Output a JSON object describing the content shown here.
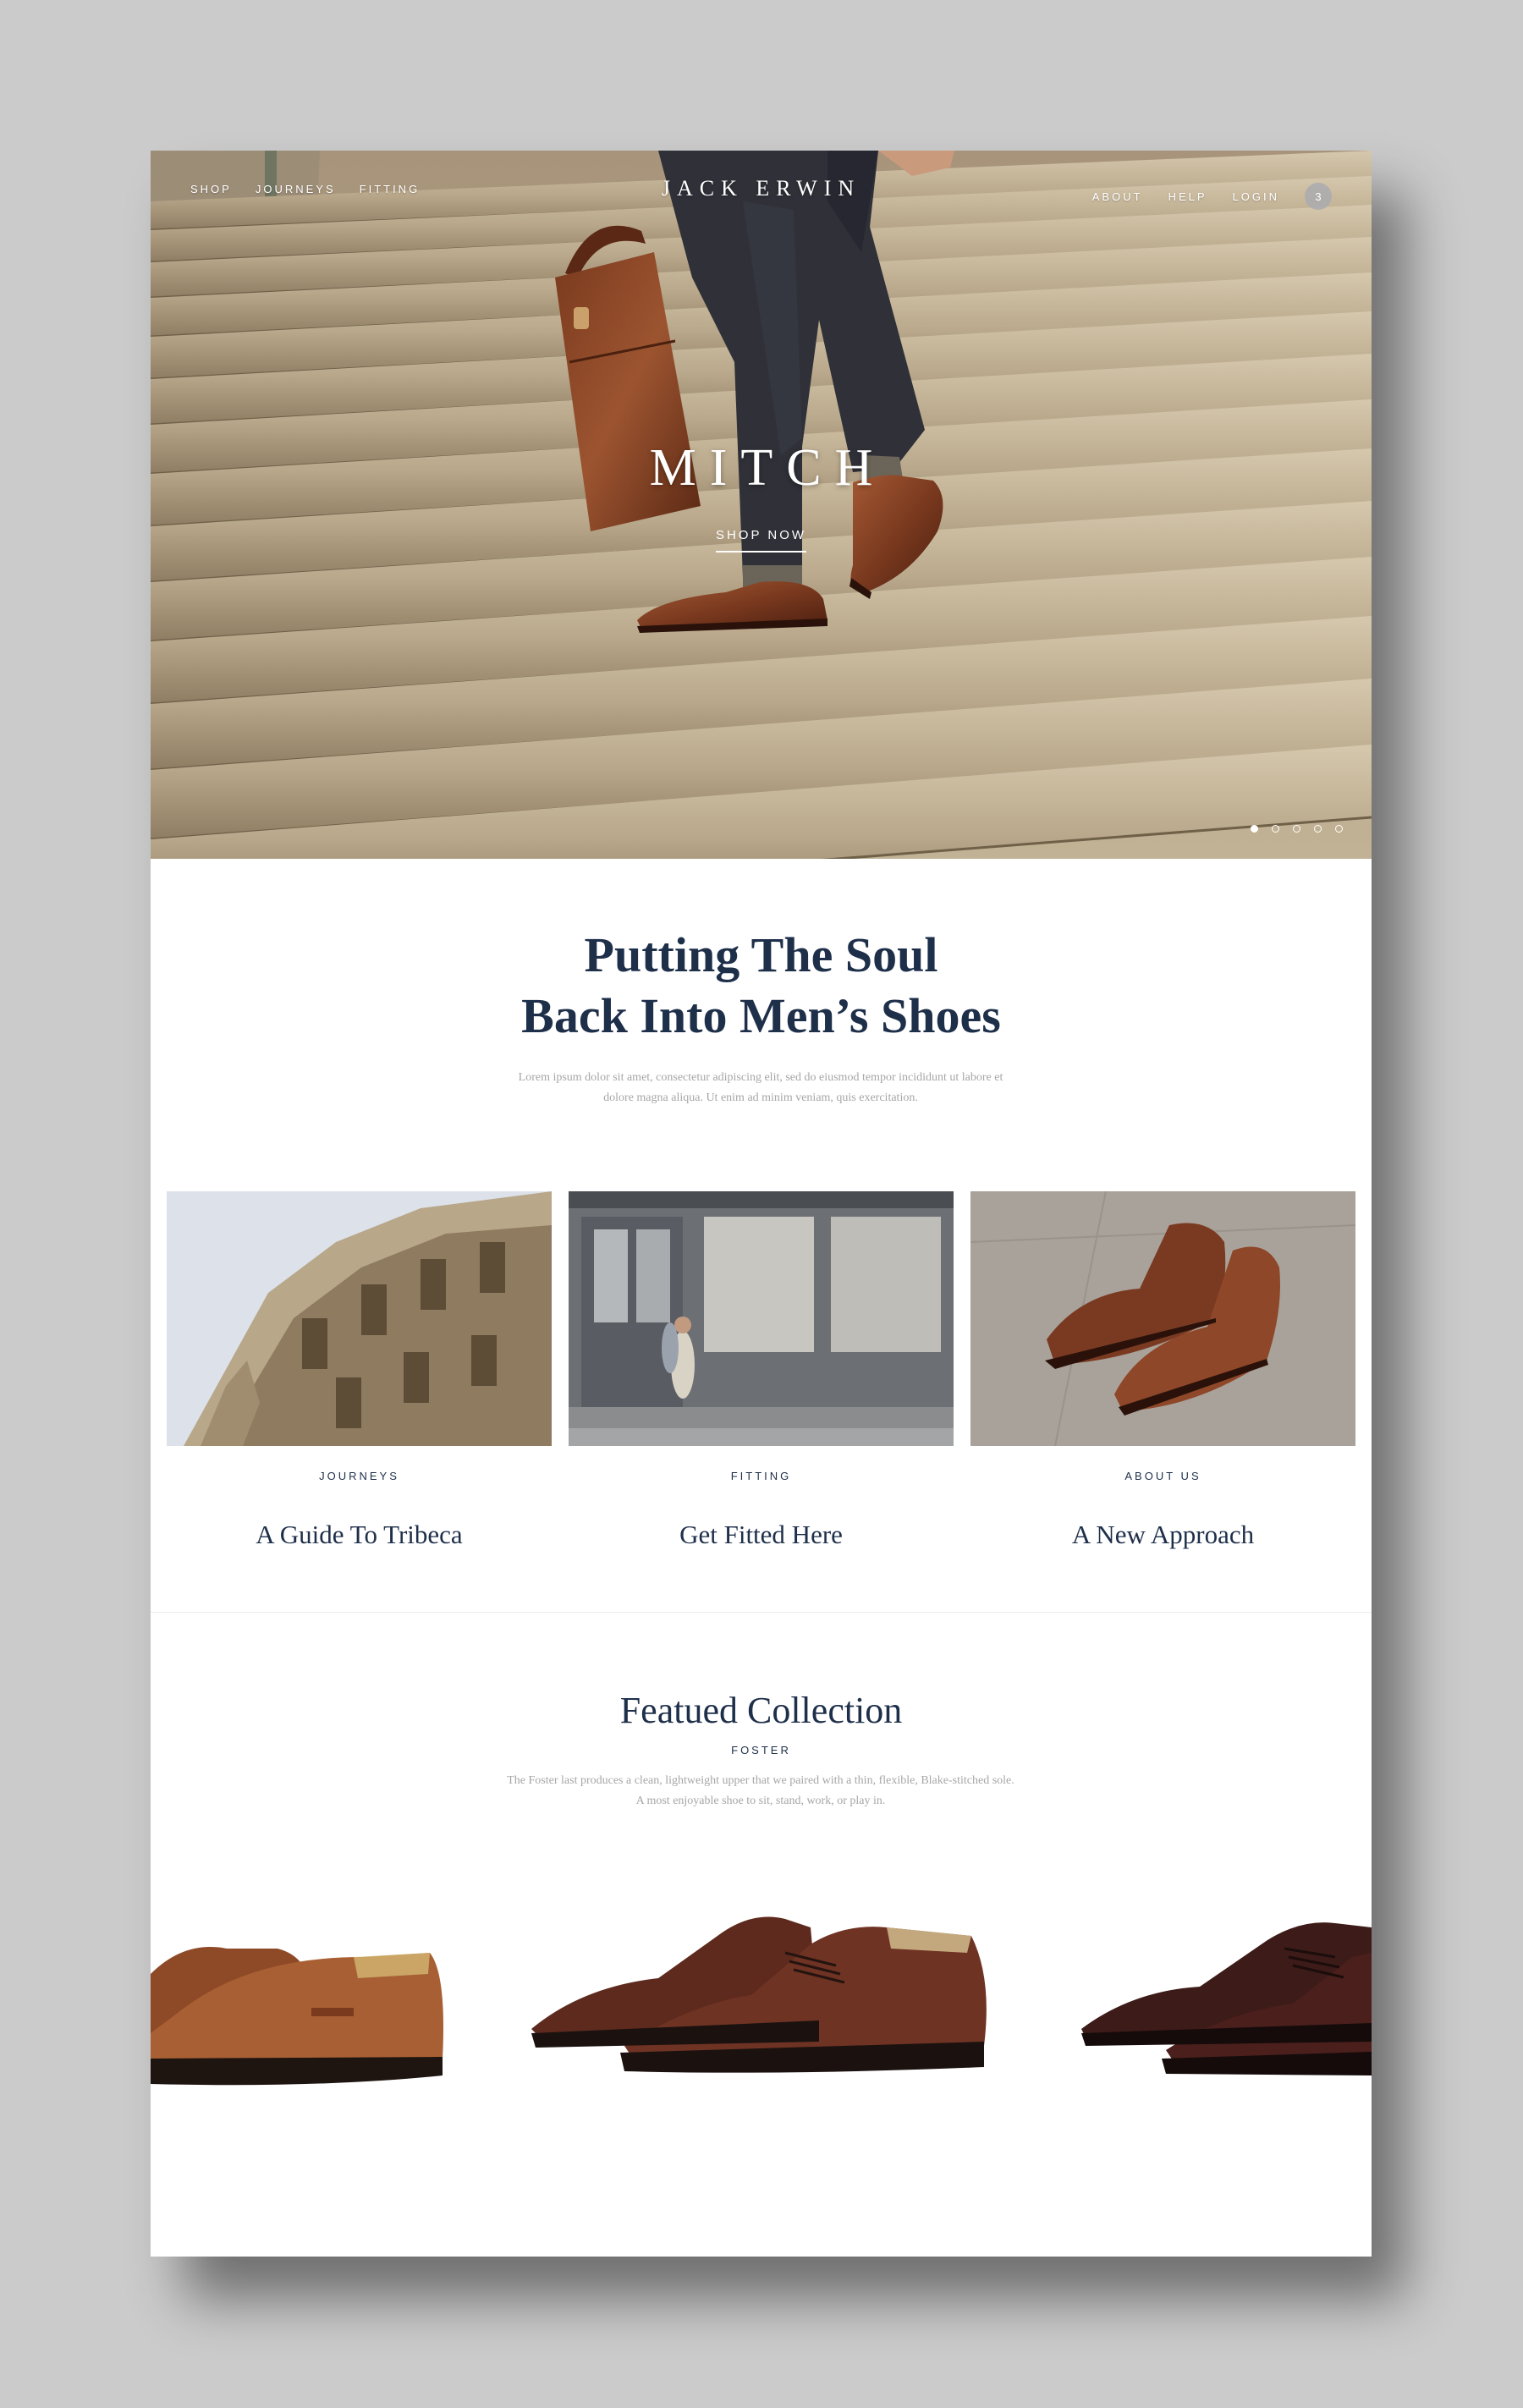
{
  "nav": {
    "left": [
      "SHOP",
      "JOURNEYS",
      "FITTING"
    ],
    "logo": "JACK ERWIN",
    "right": [
      "ABOUT",
      "HELP",
      "LOGIN"
    ],
    "cart_count": "3"
  },
  "hero": {
    "title": "MITCH",
    "cta": "SHOP NOW",
    "slides": 5,
    "active_slide": 1
  },
  "intro": {
    "title_line1": "Putting The Soul",
    "title_line2": "Back Into Men’s Shoes",
    "text": "Lorem ipsum dolor sit amet, consectetur adipiscing elit, sed do eiusmod tempor incididunt ut labore et dolore magna aliqua. Ut enim ad minim veniam, quis exercitation."
  },
  "cards": [
    {
      "eyebrow": "JOURNEYS",
      "title": "A Guide To Tribeca"
    },
    {
      "eyebrow": "FITTING",
      "title": "Get Fitted Here"
    },
    {
      "eyebrow": "ABOUT US",
      "title": "A New Approach"
    }
  ],
  "collection": {
    "title": "Featued Collection",
    "subtitle": "FOSTER",
    "text": "The Foster last produces a clean, lightweight upper that we paired with a thin, flexible, Blake-stitched sole. A most enjoyable shoe to sit, stand, work, or play in."
  },
  "colors": {
    "navy": "#1e2f4a",
    "muted_text": "#a6a6a6",
    "leather_brown": "#8a4a2e",
    "dark_brown": "#4a1f1c"
  }
}
